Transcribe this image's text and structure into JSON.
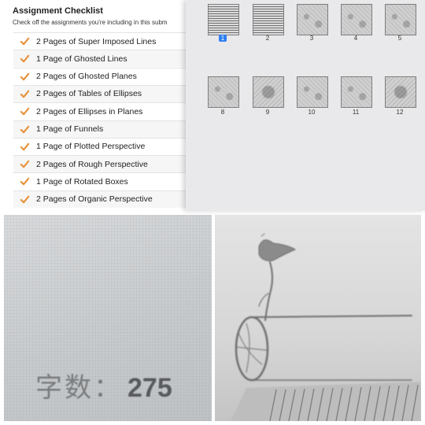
{
  "checklist": {
    "title": "Assignment Checklist",
    "subtitle": "Check off the assignments you're including in this subm",
    "items": [
      {
        "label": "2 Pages of Super Imposed Lines",
        "checked": true
      },
      {
        "label": "1 Page of Ghosted Lines",
        "checked": true
      },
      {
        "label": "2 Pages of Ghosted Planes",
        "checked": true
      },
      {
        "label": "2 Pages of Tables of Ellipses",
        "checked": true
      },
      {
        "label": "2 Pages of Ellipses in Planes",
        "checked": true
      },
      {
        "label": "1 Page of Funnels",
        "checked": true
      },
      {
        "label": "1 Page of Plotted Perspective",
        "checked": true
      },
      {
        "label": "2 Pages of Rough Perspective",
        "checked": true
      },
      {
        "label": "1 Page of Rotated Boxes",
        "checked": true
      },
      {
        "label": "2 Pages of Organic Perspective",
        "checked": true
      }
    ]
  },
  "thumbnails": {
    "selected": "1",
    "pages": [
      "1",
      "2",
      "3",
      "4",
      "5",
      "8",
      "9",
      "10",
      "11",
      "12"
    ]
  },
  "screen_photo": {
    "label": "字数：",
    "count": "275"
  },
  "colors": {
    "checkmark": "#e8913a",
    "selected_badge": "#2f7ff0",
    "grid_bg": "#e9e9eb"
  },
  "icons": {
    "check": "checkmark-icon"
  }
}
